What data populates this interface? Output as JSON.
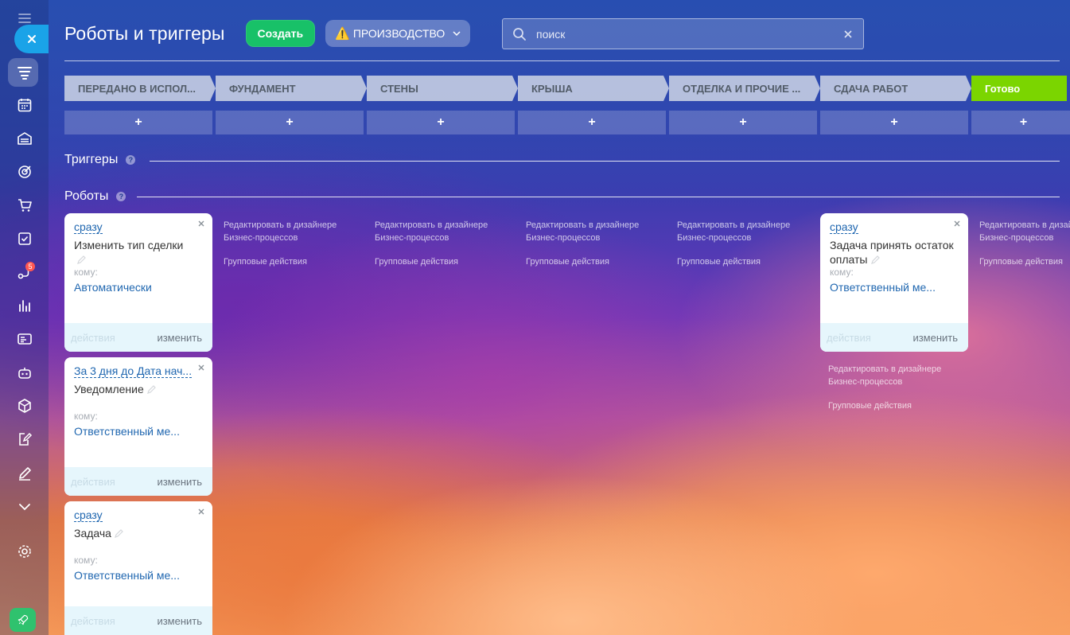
{
  "sidebar": {
    "badge_count": "5",
    "icons": [
      "menu-icon",
      "funnel-icon",
      "calendar-icon",
      "warehouse-icon",
      "target-icon",
      "cart-icon",
      "checkbox-icon",
      "automation-icon",
      "analytics-icon",
      "contact-card-icon",
      "robot-icon",
      "box-icon",
      "document-edit-icon",
      "pen-icon",
      "chevron-down-icon",
      "settings-icon"
    ]
  },
  "header": {
    "title": "Роботы и триггеры",
    "create_label": "Создать",
    "category_label": "ПРОИЗВОДСТВО",
    "category_warning": "⚠️",
    "search_placeholder": "поиск"
  },
  "stages": [
    {
      "label": "ПЕРЕДАНО В ИСПОЛ..."
    },
    {
      "label": "ФУНДАМЕНТ"
    },
    {
      "label": "СТЕНЫ"
    },
    {
      "label": "КРЫША"
    },
    {
      "label": "ОТДЕЛКА И ПРОЧИЕ ..."
    },
    {
      "label": "СДАЧА РАБОТ"
    },
    {
      "label": "Готово"
    }
  ],
  "add_symbol": "+",
  "sections": {
    "triggers": "Триггеры",
    "robots": "Роботы",
    "help": "?"
  },
  "cards": [
    {
      "condition": "сразу",
      "name": "Изменить тип сделки",
      "to_label": "кому:",
      "to_value": "Автоматически",
      "actions_label": "действия",
      "edit_label": "изменить"
    },
    {
      "condition": "За 3 дня до Дата нач...",
      "name": "Уведомление",
      "to_label": "кому:",
      "to_value": "Ответственный ме...",
      "actions_label": "действия",
      "edit_label": "изменить"
    },
    {
      "condition": "сразу",
      "name": "Задача",
      "to_label": "кому:",
      "to_value": "Ответственный ме...",
      "actions_label": "действия",
      "edit_label": "изменить"
    },
    {
      "condition": "сразу",
      "name": "Задача принять остаток оплаты",
      "to_label": "кому:",
      "to_value": "Ответственный ме...",
      "actions_label": "действия",
      "edit_label": "изменить"
    }
  ],
  "column_links": {
    "designer": "Редактировать в дизайнере Бизнес-процессов",
    "group": "Групповые действия"
  },
  "colors": {
    "create": "#18c168",
    "final_stage": "#7bd500",
    "close_button": "#1aa3e8",
    "link_blue": "#2067b0"
  }
}
